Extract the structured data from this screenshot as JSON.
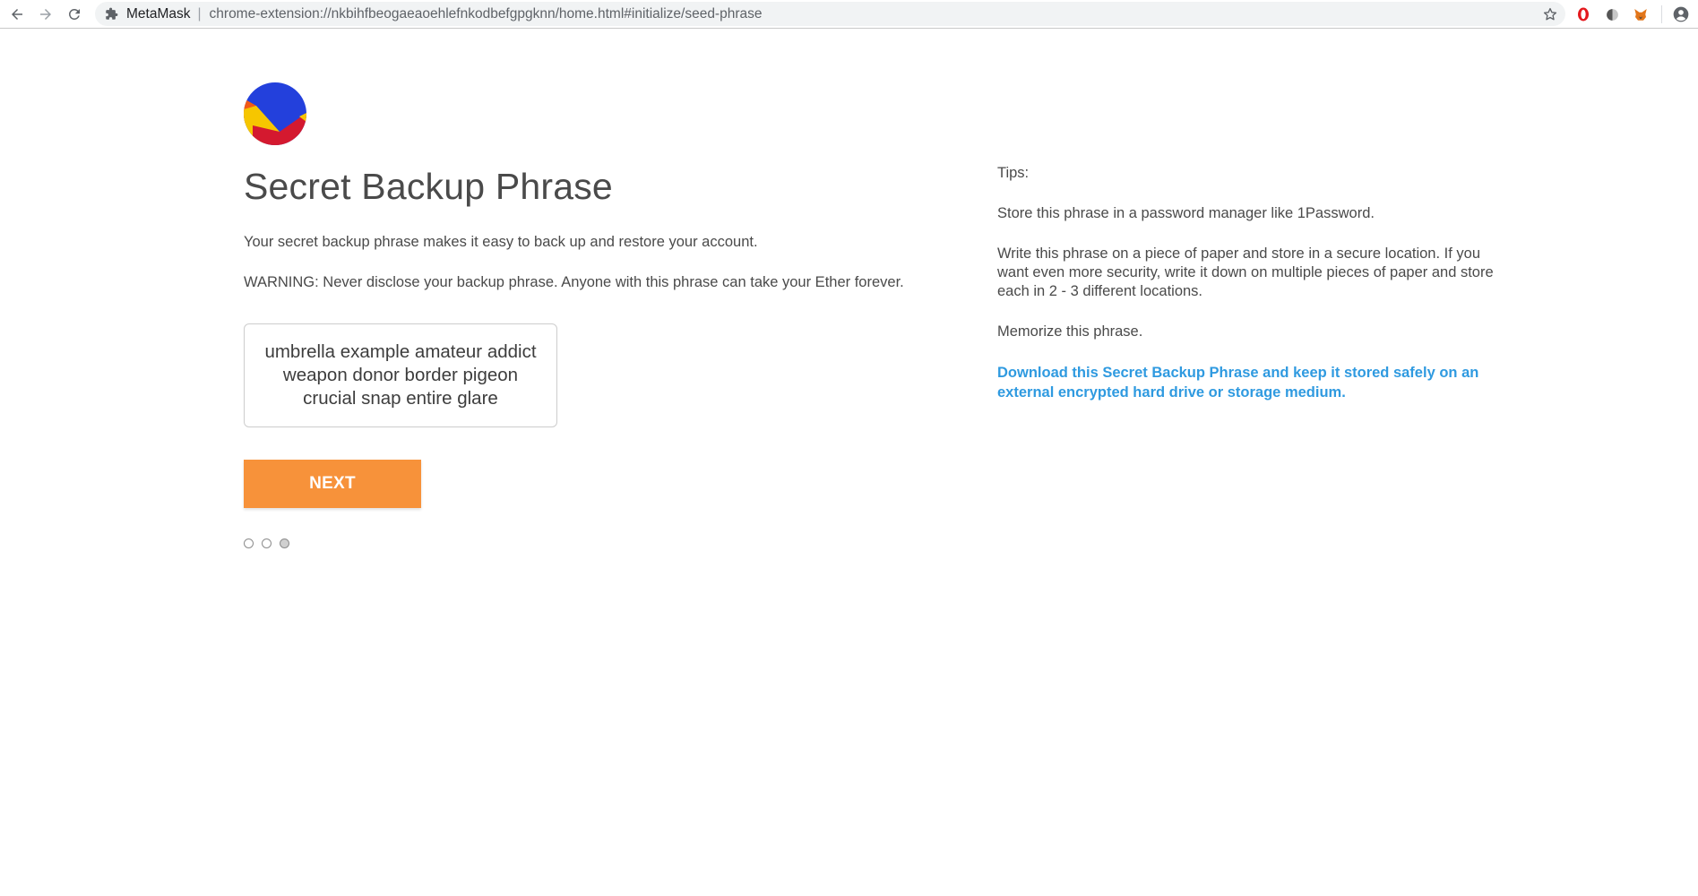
{
  "browser": {
    "site_name": "MetaMask",
    "separator": "|",
    "url": "chrome-extension://nkbihfbeogaeaoehlefnkodbefgpgknn/home.html#initialize/seed-phrase",
    "icons": {
      "back": "arrow-left-icon",
      "forward": "arrow-right-icon",
      "reload": "reload-icon",
      "extension": "puzzle-icon",
      "bookmark": "star-icon",
      "opera": "opera-icon",
      "dark_reader": "half-circle-icon",
      "metamask": "fox-icon",
      "profile": "account-circle-icon"
    }
  },
  "page": {
    "title": "Secret Backup Phrase",
    "intro": "Your secret backup phrase makes it easy to back up and restore your account.",
    "warning": "WARNING: Never disclose your backup phrase. Anyone with this phrase can take your Ether forever.",
    "seed_phrase": "umbrella example amateur addict weapon donor border pigeon crucial snap entire glare",
    "next_button": "NEXT",
    "progress": {
      "total_steps": 3,
      "current_step": 3
    },
    "colors": {
      "accent": "#f7923a",
      "link": "#2f9ae0",
      "text": "#4a4a4a"
    }
  },
  "tips": {
    "heading": "Tips:",
    "items": [
      "Store this phrase in a password manager like 1Password.",
      "Write this phrase on a piece of paper and store in a secure location. If you want even more security, write it down on multiple pieces of paper and store each in 2 - 3 different locations.",
      "Memorize this phrase."
    ],
    "download_link": "Download this Secret Backup Phrase and keep it stored safely on an external encrypted hard drive or storage medium."
  }
}
